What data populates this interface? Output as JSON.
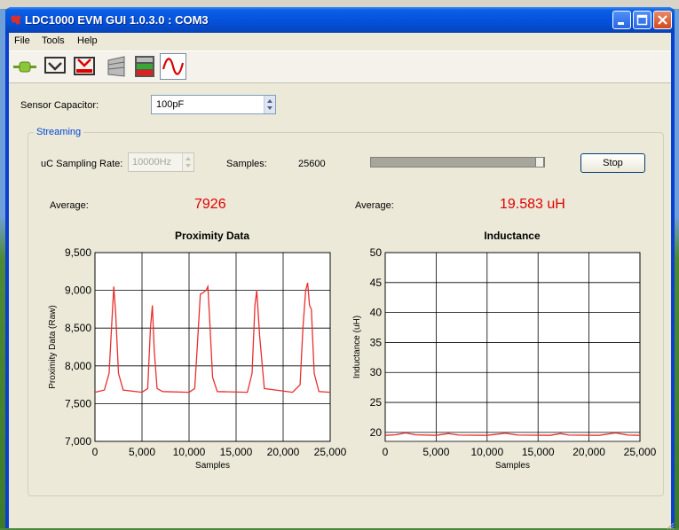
{
  "window": {
    "title": "LDC1000 EVM GUI 1.0.3.0 : COM3",
    "colors": {
      "title_bar": "#0553dd",
      "value_red": "#e00000",
      "series_red": "#e83030"
    }
  },
  "menu": {
    "items": [
      "File",
      "Tools",
      "Help"
    ]
  },
  "toolbar": {
    "icons": [
      "connect-plug-icon",
      "read-register-icon",
      "write-register-icon",
      "register-table-icon",
      "threshold-bars-icon",
      "streaming-wave-icon"
    ]
  },
  "sensor_capacitor": {
    "label": "Sensor Capacitor:",
    "value": "100pF"
  },
  "streaming": {
    "group_title": "Streaming",
    "sampling_label": "uC Sampling Rate:",
    "sampling_value": "10000Hz",
    "samples_label": "Samples:",
    "samples_value": "25600",
    "progress": 1.0,
    "stop_label": "Stop",
    "average_label_1": "Average:",
    "average_value_1": "7926",
    "average_label_2": "Average:",
    "average_value_2": "19.583 uH"
  },
  "chart_data": [
    {
      "type": "line",
      "title": "Proximity Data",
      "xlabel": "Samples",
      "ylabel": "Proximity Data (Raw)",
      "xlim": [
        0,
        25000
      ],
      "ylim": [
        7000,
        9500
      ],
      "xticks": [
        "0",
        "5,000",
        "10,000",
        "15,000",
        "20,000",
        "25,000"
      ],
      "yticks": [
        "7,000",
        "7,500",
        "8,000",
        "8,500",
        "9,000",
        "9,500"
      ],
      "grid": true,
      "series": [
        {
          "x": [
            0,
            1000,
            1500,
            1800,
            2000,
            2200,
            2500,
            3000,
            5000,
            5600,
            5900,
            6100,
            6300,
            6600,
            7200,
            10000,
            10600,
            10900,
            11200,
            11500,
            11800,
            12000,
            12200,
            12500,
            13000,
            16200,
            16700,
            17000,
            17200,
            17500,
            18000,
            21000,
            21800,
            22100,
            22400,
            22600,
            22800,
            23000,
            23300,
            23800,
            25000
          ],
          "y": [
            7650,
            7680,
            7900,
            8600,
            9050,
            8700,
            7900,
            7680,
            7650,
            7700,
            8500,
            8800,
            8200,
            7700,
            7660,
            7650,
            7700,
            8300,
            8950,
            8970,
            9000,
            9050,
            8600,
            7850,
            7660,
            7650,
            7900,
            8800,
            9000,
            8400,
            7700,
            7650,
            7750,
            8500,
            9000,
            9100,
            8800,
            8750,
            7900,
            7660,
            7650
          ]
        }
      ]
    },
    {
      "type": "line",
      "title": "Inductance",
      "xlabel": "Samples",
      "ylabel": "Inductance (uH)",
      "xlim": [
        0,
        25000
      ],
      "ylim": [
        18.5,
        50
      ],
      "xticks": [
        "0",
        "5,000",
        "10,000",
        "15,000",
        "20,000",
        "25,000"
      ],
      "yticks": [
        "20",
        "25",
        "30",
        "35",
        "40",
        "45",
        "50"
      ],
      "grid": true,
      "series": [
        {
          "x": [
            0,
            1000,
            2000,
            3000,
            5000,
            6200,
            7200,
            10000,
            11800,
            13000,
            16200,
            17200,
            18000,
            21000,
            22600,
            23800,
            25000
          ],
          "y": [
            19.5,
            19.6,
            19.9,
            19.6,
            19.5,
            19.8,
            19.55,
            19.5,
            19.85,
            19.55,
            19.5,
            19.8,
            19.55,
            19.5,
            19.9,
            19.55,
            19.5
          ]
        }
      ]
    }
  ]
}
